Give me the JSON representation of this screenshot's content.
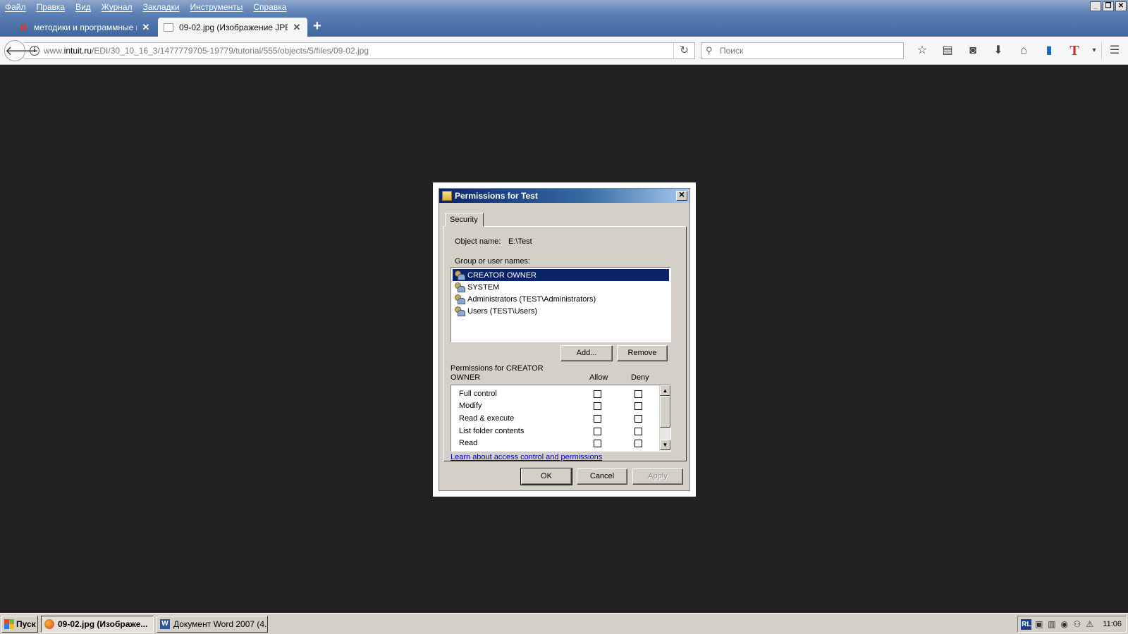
{
  "browser": {
    "menu": [
      "Файл",
      "Правка",
      "Вид",
      "Журнал",
      "Закладки",
      "Инструменты",
      "Справка"
    ],
    "tabs": [
      {
        "label": "методики и программные пр...",
        "active": false
      },
      {
        "label": "09-02.jpg (Изображение JPE...",
        "active": true
      }
    ],
    "new_tab_symbol": "+",
    "url": {
      "prefix": "www.",
      "host": "intuit.ru",
      "path": "/EDI/30_10_16_3/1477779705-19779/tutorial/555/objects/5/files/09-02.jpg"
    },
    "search_placeholder": "Поиск",
    "toolbar_icons": [
      "star-icon",
      "reading-list-icon",
      "pocket-icon",
      "download-icon",
      "home-icon",
      "books-icon",
      "translate-icon",
      "dropdown-icon",
      "menu-icon"
    ]
  },
  "dialog": {
    "title": "Permissions for Test",
    "tab": "Security",
    "object_name_label": "Object name:",
    "object_name_value": "E:\\Test",
    "group_label": "Group or user names:",
    "users": [
      {
        "name": "CREATOR OWNER",
        "selected": true
      },
      {
        "name": "SYSTEM",
        "selected": false
      },
      {
        "name": "Administrators (TEST\\Administrators)",
        "selected": false
      },
      {
        "name": "Users (TEST\\Users)",
        "selected": false
      }
    ],
    "add_button": "Add...",
    "remove_button": "Remove",
    "permissions_label_line1": "Permissions for CREATOR",
    "permissions_label_line2": "OWNER",
    "allow_header": "Allow",
    "deny_header": "Deny",
    "permissions": [
      {
        "name": "Full control",
        "allow": false,
        "deny": false
      },
      {
        "name": "Modify",
        "allow": false,
        "deny": false
      },
      {
        "name": "Read & execute",
        "allow": false,
        "deny": false
      },
      {
        "name": "List folder contents",
        "allow": false,
        "deny": false
      },
      {
        "name": "Read",
        "allow": false,
        "deny": false
      }
    ],
    "learn_link": "Learn about access control and permissions",
    "ok_button": "OK",
    "cancel_button": "Cancel",
    "apply_button": "Apply"
  },
  "taskbar": {
    "start": "Пуск",
    "tasks": [
      {
        "label": "09-02.jpg (Изображе...",
        "active": true
      },
      {
        "label": "Документ Word 2007 (4...",
        "active": false
      }
    ],
    "lang": "RL",
    "clock": "11:06"
  }
}
